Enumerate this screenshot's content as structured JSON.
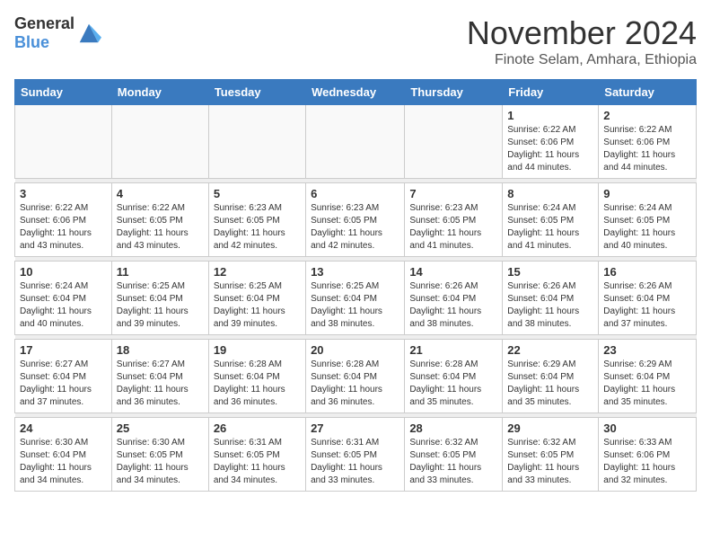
{
  "header": {
    "logo_general": "General",
    "logo_blue": "Blue",
    "month_title": "November 2024",
    "subtitle": "Finote Selam, Amhara, Ethiopia"
  },
  "weekdays": [
    "Sunday",
    "Monday",
    "Tuesday",
    "Wednesday",
    "Thursday",
    "Friday",
    "Saturday"
  ],
  "weeks": [
    [
      {
        "day": "",
        "empty": true
      },
      {
        "day": "",
        "empty": true
      },
      {
        "day": "",
        "empty": true
      },
      {
        "day": "",
        "empty": true
      },
      {
        "day": "",
        "empty": true
      },
      {
        "day": "1",
        "sunrise": "Sunrise: 6:22 AM",
        "sunset": "Sunset: 6:06 PM",
        "daylight": "Daylight: 11 hours and 44 minutes."
      },
      {
        "day": "2",
        "sunrise": "Sunrise: 6:22 AM",
        "sunset": "Sunset: 6:06 PM",
        "daylight": "Daylight: 11 hours and 44 minutes."
      }
    ],
    [
      {
        "day": "3",
        "sunrise": "Sunrise: 6:22 AM",
        "sunset": "Sunset: 6:06 PM",
        "daylight": "Daylight: 11 hours and 43 minutes."
      },
      {
        "day": "4",
        "sunrise": "Sunrise: 6:22 AM",
        "sunset": "Sunset: 6:05 PM",
        "daylight": "Daylight: 11 hours and 43 minutes."
      },
      {
        "day": "5",
        "sunrise": "Sunrise: 6:23 AM",
        "sunset": "Sunset: 6:05 PM",
        "daylight": "Daylight: 11 hours and 42 minutes."
      },
      {
        "day": "6",
        "sunrise": "Sunrise: 6:23 AM",
        "sunset": "Sunset: 6:05 PM",
        "daylight": "Daylight: 11 hours and 42 minutes."
      },
      {
        "day": "7",
        "sunrise": "Sunrise: 6:23 AM",
        "sunset": "Sunset: 6:05 PM",
        "daylight": "Daylight: 11 hours and 41 minutes."
      },
      {
        "day": "8",
        "sunrise": "Sunrise: 6:24 AM",
        "sunset": "Sunset: 6:05 PM",
        "daylight": "Daylight: 11 hours and 41 minutes."
      },
      {
        "day": "9",
        "sunrise": "Sunrise: 6:24 AM",
        "sunset": "Sunset: 6:05 PM",
        "daylight": "Daylight: 11 hours and 40 minutes."
      }
    ],
    [
      {
        "day": "10",
        "sunrise": "Sunrise: 6:24 AM",
        "sunset": "Sunset: 6:04 PM",
        "daylight": "Daylight: 11 hours and 40 minutes."
      },
      {
        "day": "11",
        "sunrise": "Sunrise: 6:25 AM",
        "sunset": "Sunset: 6:04 PM",
        "daylight": "Daylight: 11 hours and 39 minutes."
      },
      {
        "day": "12",
        "sunrise": "Sunrise: 6:25 AM",
        "sunset": "Sunset: 6:04 PM",
        "daylight": "Daylight: 11 hours and 39 minutes."
      },
      {
        "day": "13",
        "sunrise": "Sunrise: 6:25 AM",
        "sunset": "Sunset: 6:04 PM",
        "daylight": "Daylight: 11 hours and 38 minutes."
      },
      {
        "day": "14",
        "sunrise": "Sunrise: 6:26 AM",
        "sunset": "Sunset: 6:04 PM",
        "daylight": "Daylight: 11 hours and 38 minutes."
      },
      {
        "day": "15",
        "sunrise": "Sunrise: 6:26 AM",
        "sunset": "Sunset: 6:04 PM",
        "daylight": "Daylight: 11 hours and 38 minutes."
      },
      {
        "day": "16",
        "sunrise": "Sunrise: 6:26 AM",
        "sunset": "Sunset: 6:04 PM",
        "daylight": "Daylight: 11 hours and 37 minutes."
      }
    ],
    [
      {
        "day": "17",
        "sunrise": "Sunrise: 6:27 AM",
        "sunset": "Sunset: 6:04 PM",
        "daylight": "Daylight: 11 hours and 37 minutes."
      },
      {
        "day": "18",
        "sunrise": "Sunrise: 6:27 AM",
        "sunset": "Sunset: 6:04 PM",
        "daylight": "Daylight: 11 hours and 36 minutes."
      },
      {
        "day": "19",
        "sunrise": "Sunrise: 6:28 AM",
        "sunset": "Sunset: 6:04 PM",
        "daylight": "Daylight: 11 hours and 36 minutes."
      },
      {
        "day": "20",
        "sunrise": "Sunrise: 6:28 AM",
        "sunset": "Sunset: 6:04 PM",
        "daylight": "Daylight: 11 hours and 36 minutes."
      },
      {
        "day": "21",
        "sunrise": "Sunrise: 6:28 AM",
        "sunset": "Sunset: 6:04 PM",
        "daylight": "Daylight: 11 hours and 35 minutes."
      },
      {
        "day": "22",
        "sunrise": "Sunrise: 6:29 AM",
        "sunset": "Sunset: 6:04 PM",
        "daylight": "Daylight: 11 hours and 35 minutes."
      },
      {
        "day": "23",
        "sunrise": "Sunrise: 6:29 AM",
        "sunset": "Sunset: 6:04 PM",
        "daylight": "Daylight: 11 hours and 35 minutes."
      }
    ],
    [
      {
        "day": "24",
        "sunrise": "Sunrise: 6:30 AM",
        "sunset": "Sunset: 6:04 PM",
        "daylight": "Daylight: 11 hours and 34 minutes."
      },
      {
        "day": "25",
        "sunrise": "Sunrise: 6:30 AM",
        "sunset": "Sunset: 6:05 PM",
        "daylight": "Daylight: 11 hours and 34 minutes."
      },
      {
        "day": "26",
        "sunrise": "Sunrise: 6:31 AM",
        "sunset": "Sunset: 6:05 PM",
        "daylight": "Daylight: 11 hours and 34 minutes."
      },
      {
        "day": "27",
        "sunrise": "Sunrise: 6:31 AM",
        "sunset": "Sunset: 6:05 PM",
        "daylight": "Daylight: 11 hours and 33 minutes."
      },
      {
        "day": "28",
        "sunrise": "Sunrise: 6:32 AM",
        "sunset": "Sunset: 6:05 PM",
        "daylight": "Daylight: 11 hours and 33 minutes."
      },
      {
        "day": "29",
        "sunrise": "Sunrise: 6:32 AM",
        "sunset": "Sunset: 6:05 PM",
        "daylight": "Daylight: 11 hours and 33 minutes."
      },
      {
        "day": "30",
        "sunrise": "Sunrise: 6:33 AM",
        "sunset": "Sunset: 6:06 PM",
        "daylight": "Daylight: 11 hours and 32 minutes."
      }
    ]
  ]
}
